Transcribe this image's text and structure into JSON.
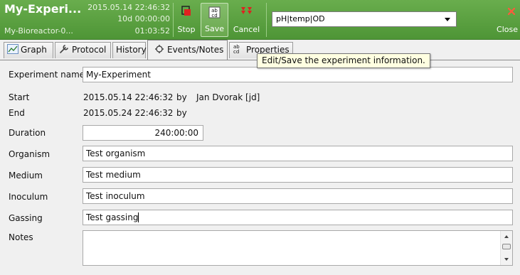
{
  "header": {
    "title": "My-Experi...",
    "subtitle": "My-Bioreactor-0...",
    "start_time": "2015.05.14 22:46:32",
    "duration": "10d 00:00:00",
    "elapsed": "01:03:52",
    "stop_label": "Stop",
    "save_label": "Save",
    "cancel_label": "Cancel",
    "close_label": "Close",
    "variables_combo": "pH|temp|OD",
    "colors": {
      "bar": "#5aa040",
      "stop_icon": "#e02020",
      "cancel_icon": "#e02020",
      "close_icon": "#ff5a3c"
    }
  },
  "tabs": [
    {
      "label": "Graph",
      "icon": "graph-icon"
    },
    {
      "label": "Protocol",
      "icon": "wrench-icon"
    },
    {
      "label": "History"
    },
    {
      "label": "Events/Notes",
      "icon": "events-icon",
      "active": true
    },
    {
      "label": "Properties",
      "icon": "abc-icon"
    }
  ],
  "tooltip": "Edit/Save the experiment information.",
  "form": {
    "experiment_name": {
      "label": "Experiment name",
      "value": "My-Experiment"
    },
    "start": {
      "label": "Start",
      "value": "2015.05.14 22:46:32",
      "by": "by",
      "user": "Jan Dvorak [jd]"
    },
    "end": {
      "label": "End",
      "value": "2015.05.24 22:46:32",
      "by": "by"
    },
    "duration": {
      "label": "Duration",
      "value": "240:00:00"
    },
    "organism": {
      "label": "Organism",
      "value": "Test organism"
    },
    "medium": {
      "label": "Medium",
      "value": "Test medium"
    },
    "inoculum": {
      "label": "Inoculum",
      "value": "Test inoculum"
    },
    "gassing": {
      "label": "Gassing",
      "value": "Test gassing"
    },
    "notes": {
      "label": "Notes",
      "value": ""
    }
  }
}
